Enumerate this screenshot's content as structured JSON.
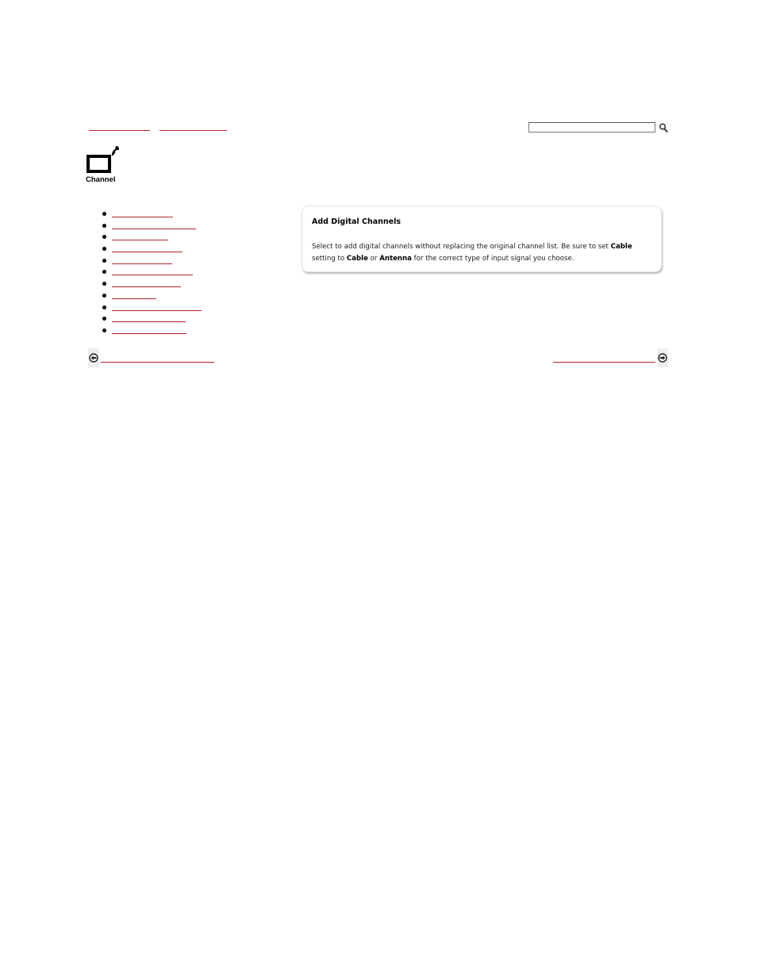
{
  "breadcrumb": {
    "items": [
      {
        "label": ""
      },
      {
        "label": ""
      }
    ]
  },
  "search": {
    "value": "",
    "placeholder": "",
    "button_icon": "search-icon"
  },
  "category": {
    "label": "Channel",
    "icon": "tv-broadcast-icon"
  },
  "nav_list": {
    "items": [
      {
        "label": ""
      },
      {
        "label": ""
      },
      {
        "label": ""
      },
      {
        "label": ""
      },
      {
        "label": ""
      },
      {
        "label": ""
      },
      {
        "label": ""
      },
      {
        "label": ""
      },
      {
        "label": ""
      },
      {
        "label": ""
      },
      {
        "label": ""
      }
    ]
  },
  "info_card": {
    "title": "Add Digital Channels",
    "body": {
      "text1": "Select to add digital channels without replacing the original channel list. Be sure to set ",
      "bold1": "Cable",
      "text2": " setting to ",
      "bold2": "Cable",
      "text3": " or ",
      "bold3": "Antenna",
      "text4": " for the correct type of input signal you choose."
    }
  },
  "pager": {
    "prev_label": "",
    "next_label": "",
    "prev_icon": "arrow-left-icon",
    "next_icon": "arrow-right-icon"
  },
  "colors": {
    "link": "#b2262a",
    "card_border": "#e3e3e3"
  }
}
